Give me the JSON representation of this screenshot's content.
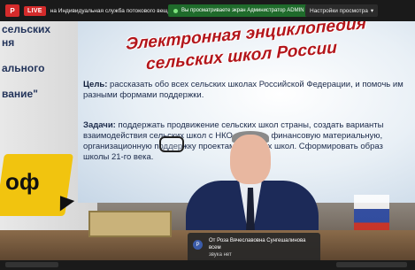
{
  "topbar": {
    "logo": "P",
    "live": "LIVE",
    "stream_title": "на Индивидуальная служба потокового вещания",
    "admin_banner": "Вы просматриваете экран Администратор ADMIN",
    "view_settings": "Настройки просмотра"
  },
  "slide": {
    "left_lines": [
      "сельских",
      "ня",
      "ального",
      "вание\""
    ],
    "yellow_text": "оф",
    "title_line1": "Электронная энциклопедия",
    "title_line2": "сельских школ России",
    "goal_label": "Цель:",
    "goal_text": "рассказать обо всех сельских школах Российской Федерации, и помочь им разными формами поддержки.",
    "tasks_label": "Задачи:",
    "tasks_text": "поддержать продвижение сельских школ страны, создать варианты взаимодействия сельских школ с НКО. Оказать финансовую материальную, организационную поддержку проектам сельских школ. Сформировать образ школы 21-го века."
  },
  "chat": {
    "avatar_letter": "Р",
    "from": "От Роза Вячеславовна Сунгешалинова всем",
    "message": "звука нет"
  },
  "colors": {
    "live_red": "#d42b2b",
    "admin_green": "#1f6b2b",
    "title_red": "#b3161b"
  }
}
